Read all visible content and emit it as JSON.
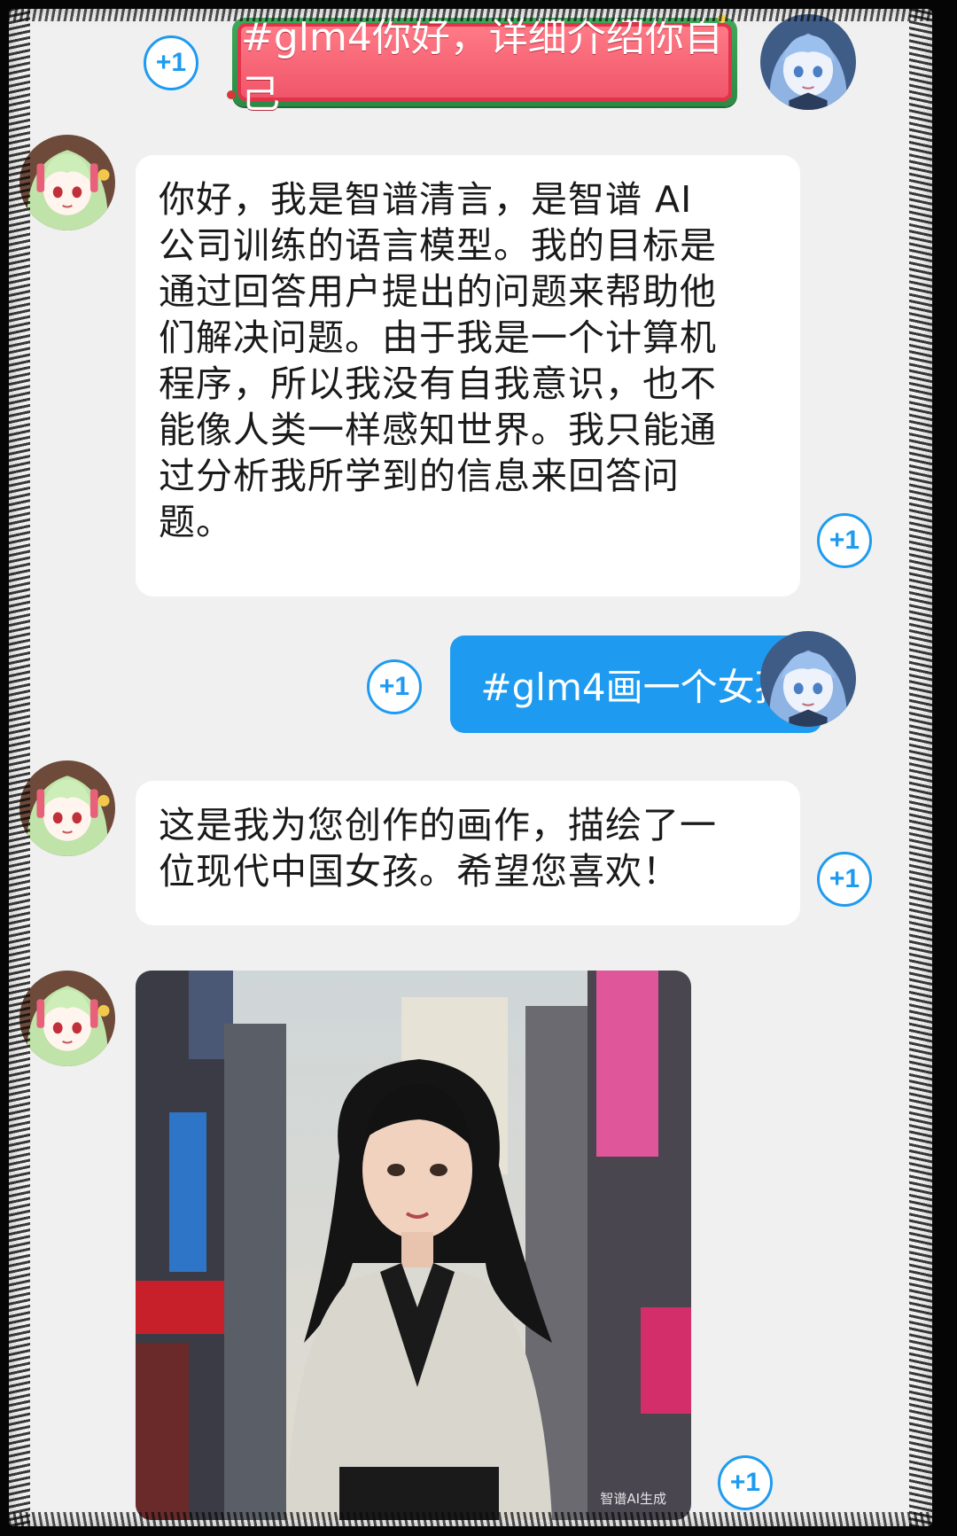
{
  "messages": [
    {
      "id": "m1",
      "role": "user",
      "text": "#glm4你好，详细介绍你自己"
    },
    {
      "id": "m2",
      "role": "bot",
      "text": "你好，我是智谱清言，是智谱 AI 公司训练的语言模型。我的目标是通过回答用户提出的问题来帮助他们解决问题。由于我是一个计算机程序，所以我没有自我意识，也不能像人类一样感知世界。我只能通过分析我所学到的信息来回答问题。",
      "lines": [
        "你好，我是智谱清言，是智谱 AI",
        "公司训练的语言模型。我的目标是",
        "通过回答用户提出的问题来帮助他",
        "们解决问题。由于我是一个计算机",
        "程序，所以我没有自我意识，也不",
        "能像人类一样感知世界。我只能通",
        "过分析我所学到的信息来回答问",
        "题。"
      ]
    },
    {
      "id": "m3",
      "role": "user",
      "text": "#glm4画一个女孩"
    },
    {
      "id": "m4",
      "role": "bot",
      "text": "这是我为您创作的画作，描绘了一位现代中国女孩。希望您喜欢！",
      "lines": [
        "这是我为您创作的画作，描绘了一",
        "位现代中国女孩。希望您喜欢！"
      ]
    },
    {
      "id": "m5",
      "role": "bot",
      "type": "image",
      "watermark": "智谱AI生成"
    }
  ],
  "plus_one_label": "+1",
  "colors": {
    "accent": "#1e9bf0",
    "chat_bg": "#f0f0f0",
    "xmas_green": "#3fa85a",
    "xmas_red": "#e2334a"
  },
  "icons": {
    "bot_avatar": "green-hair-anime-girl-avatar",
    "user_avatar": "blue-hair-anime-girl-avatar"
  }
}
